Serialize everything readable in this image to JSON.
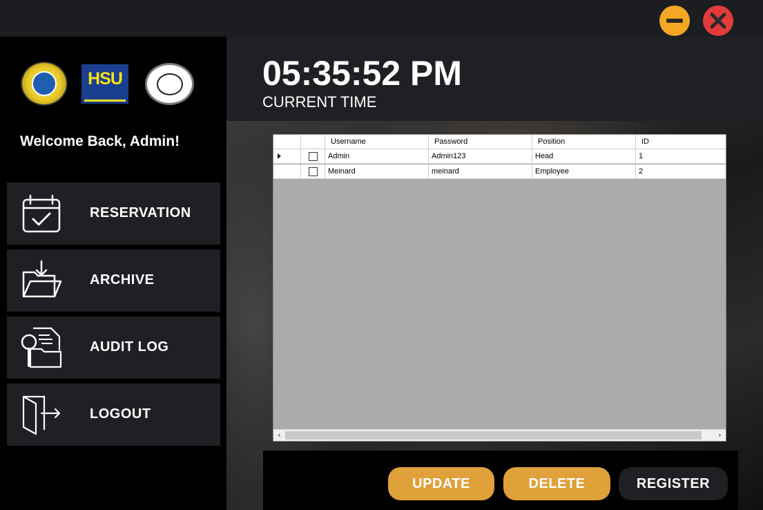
{
  "window": {
    "minimize_icon": "minimize-icon",
    "close_icon": "close-icon"
  },
  "sidebar": {
    "welcome": "Welcome Back, Admin!",
    "logos": [
      "university-seal-logo",
      "hsu-logo",
      "fitness-center-logo"
    ],
    "items": [
      {
        "label": "RESERVATION",
        "icon": "calendar-check-icon"
      },
      {
        "label": "ARCHIVE",
        "icon": "folder-download-icon"
      },
      {
        "label": "AUDIT LOG",
        "icon": "document-search-icon"
      },
      {
        "label": "LOGOUT",
        "icon": "logout-door-icon"
      }
    ]
  },
  "header": {
    "time": "05:35:52 PM",
    "time_label": "CURRENT TIME"
  },
  "grid": {
    "columns": [
      "Username",
      "Password",
      "Position",
      "ID"
    ],
    "rows": [
      {
        "username": "Admin",
        "password": "Admin123",
        "position": "Head",
        "id": "1",
        "selected": true
      },
      {
        "username": "Meinard",
        "password": "meinard",
        "position": "Employee",
        "id": "2",
        "selected": false
      }
    ]
  },
  "actions": {
    "update": "UPDATE",
    "delete": "DELETE",
    "register": "REGISTER"
  },
  "colors": {
    "accent": "#e0a03a",
    "panel": "#1f2024",
    "minimize": "#f5a623",
    "close": "#e23b3b"
  }
}
